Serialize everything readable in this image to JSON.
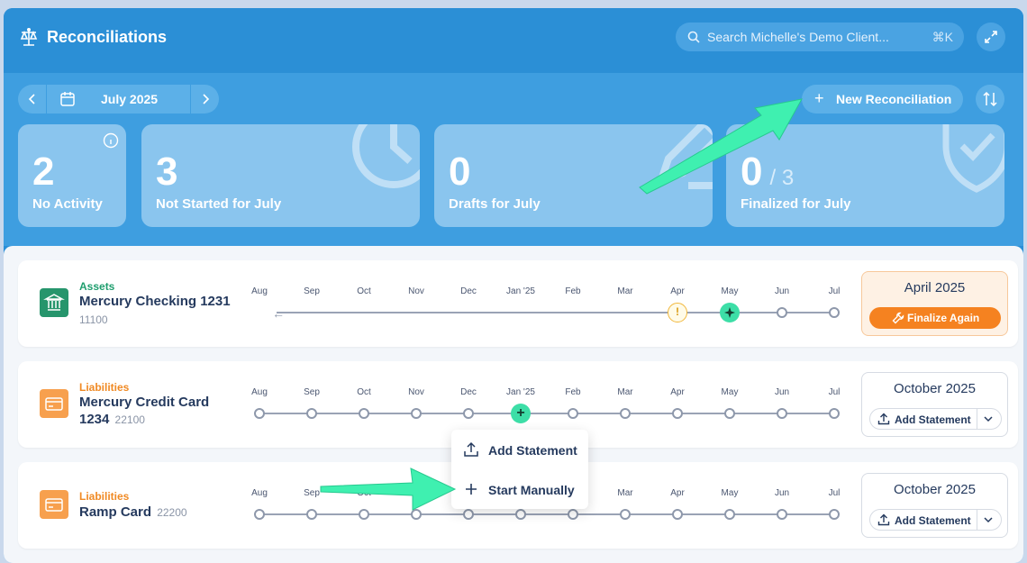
{
  "header": {
    "title": "Reconciliations",
    "search_placeholder": "Search Michelle's Demo Client...",
    "search_shortcut": "⌘K"
  },
  "toolbar": {
    "month": "July 2025",
    "new_reconciliation_label": "New Reconciliation"
  },
  "stats": [
    {
      "value": "2",
      "label": "No Activity"
    },
    {
      "value": "3",
      "label": "Not Started for July"
    },
    {
      "value": "0",
      "label": "Drafts for July"
    },
    {
      "value": "0",
      "suffix": "/ 3",
      "label": "Finalized for July"
    }
  ],
  "timeline_months": [
    "Aug",
    "Sep",
    "Oct",
    "Nov",
    "Dec",
    "Jan '25",
    "Feb",
    "Mar",
    "Apr",
    "May",
    "Jun",
    "Jul"
  ],
  "accounts": [
    {
      "type": "Assets",
      "type_color": "#1f9e6e",
      "name": "Mercury Checking 1231",
      "code": "11100",
      "status_title": "April 2025",
      "action_label": "Finalize Again",
      "warning_glyph": "!"
    },
    {
      "type": "Liabilities",
      "type_color": "#f08a24",
      "name_line1": "Mercury Credit Card",
      "name_line2": "1234",
      "code": "22100",
      "status_title": "October 2025",
      "action_label": "Add Statement"
    },
    {
      "type": "Liabilities",
      "type_color": "#f08a24",
      "name": "Ramp Card",
      "code": "22200",
      "status_title": "October 2025",
      "action_label": "Add Statement"
    }
  ],
  "popover": {
    "items": [
      "Add Statement",
      "Start Manually"
    ]
  },
  "colors": {
    "brand_blue": "#2a8fd8",
    "accent_green": "#3ddea7",
    "orange": "#f58220"
  }
}
